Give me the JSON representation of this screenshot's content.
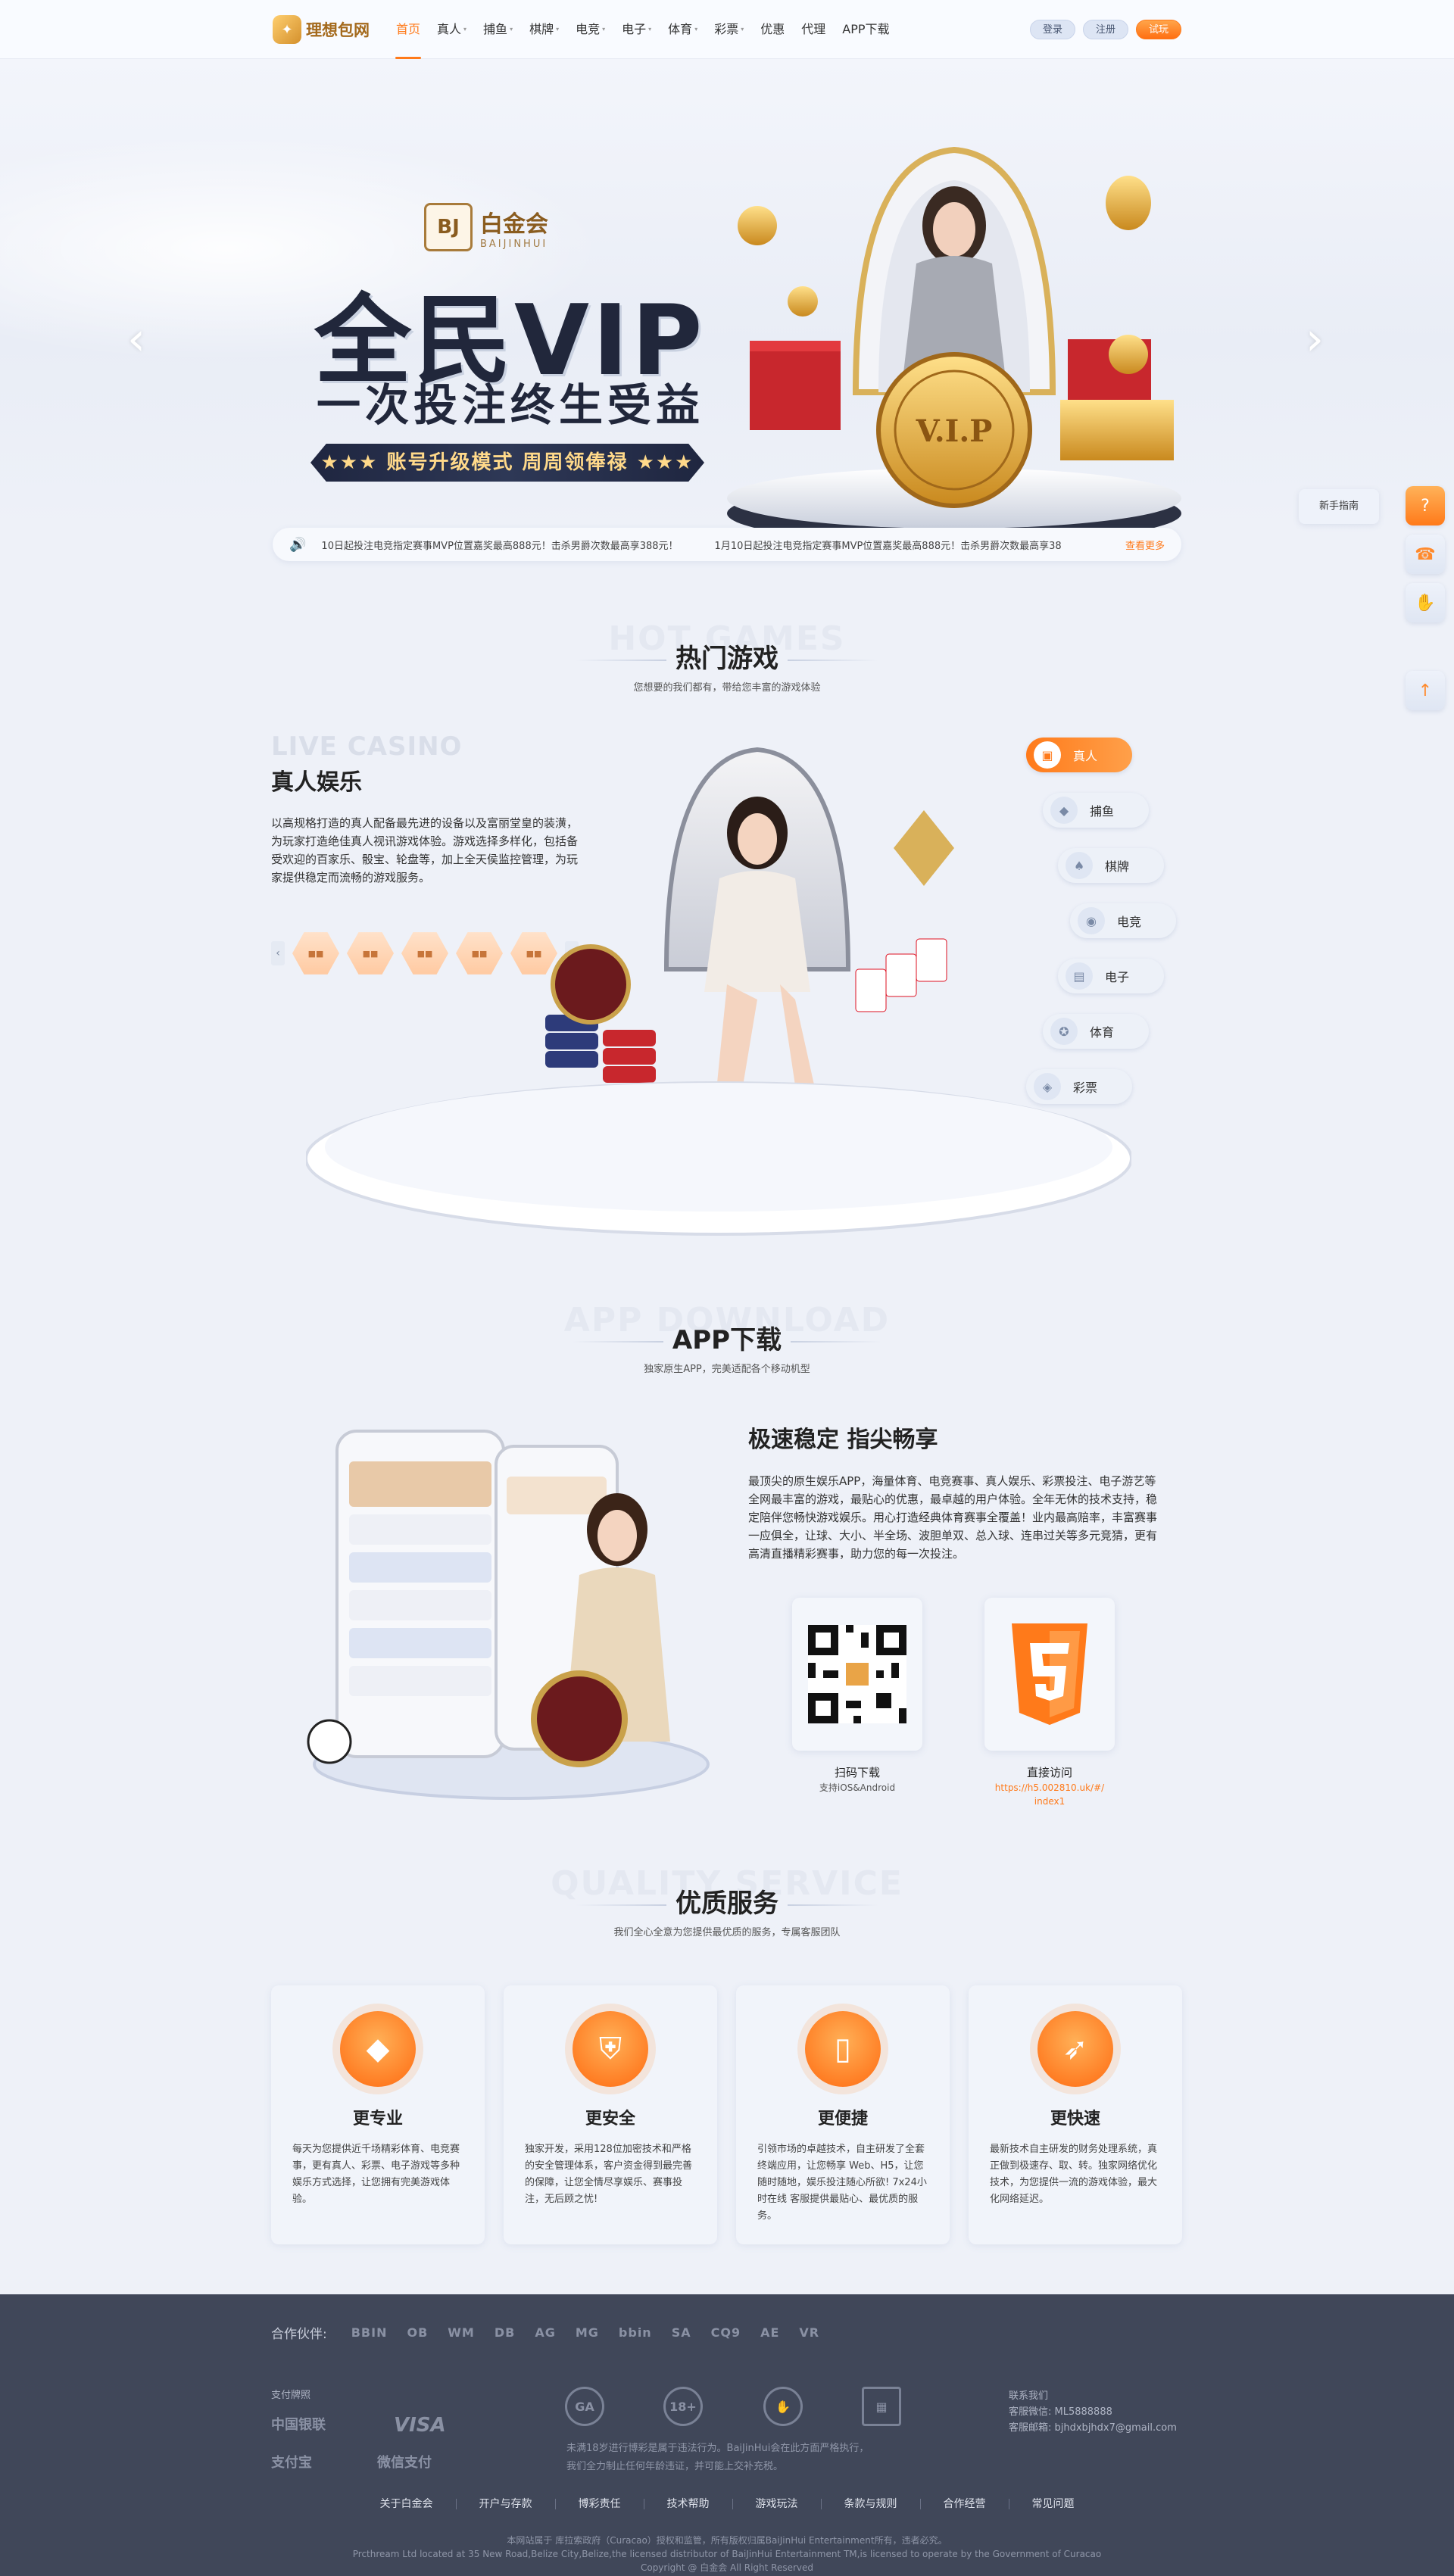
{
  "header": {
    "logo_text": "理想包网",
    "nav": [
      {
        "label": "首页",
        "active": true,
        "caret": false
      },
      {
        "label": "真人",
        "active": false,
        "caret": true
      },
      {
        "label": "捕鱼",
        "active": false,
        "caret": true
      },
      {
        "label": "棋牌",
        "active": false,
        "caret": true
      },
      {
        "label": "电竞",
        "active": false,
        "caret": true
      },
      {
        "label": "电子",
        "active": false,
        "caret": true
      },
      {
        "label": "体育",
        "active": false,
        "caret": true
      },
      {
        "label": "彩票",
        "active": false,
        "caret": true
      },
      {
        "label": "优惠",
        "active": false,
        "caret": false
      },
      {
        "label": "代理",
        "active": false,
        "caret": false
      },
      {
        "label": "APP下载",
        "active": false,
        "caret": false
      }
    ],
    "login": "登录",
    "register": "注册",
    "trial": "试玩"
  },
  "banner": {
    "brand_mark": "BJ",
    "brand_name": "白金会",
    "brand_sub": "BAIJINHUI",
    "title": "全民VIP",
    "subtitle": "一次投注终生受益",
    "ribbon": "★★★ 账号升级模式 周周领俸禄 ★★★",
    "slides": 4,
    "active_slide": 2
  },
  "notice": {
    "messages": [
      "10日起投注电竞指定赛事MVP位置嘉奖最高888元！击杀男爵次数最高享388元！",
      "1月10日起投注电竞指定赛事MVP位置嘉奖最高888元！击杀男爵次数最高享38"
    ],
    "more": "查看更多"
  },
  "side": {
    "guide": "新手指南"
  },
  "hot": {
    "ghost": "HOT GAMES",
    "title": "热门游戏",
    "desc": "您想要的我们都有，带给您丰富的游戏体验",
    "live_ghost": "LIVE CASINO",
    "live_title": "真人娱乐",
    "live_desc": "以高规格打造的真人配备最先进的设备以及富丽堂皇的装潢，为玩家打造绝佳真人视讯游戏体验。游戏选择多样化，包括备受欢迎的百家乐、骰宝、轮盘等，加上全天侯监控管理，为玩家提供稳定而流畅的游戏服务。",
    "thumbs": [
      "■■",
      "■■",
      "■■",
      "■■",
      "■■"
    ],
    "tabs": [
      {
        "label": "真人",
        "icon": "▣",
        "active": true
      },
      {
        "label": "捕鱼",
        "icon": "◆",
        "active": false
      },
      {
        "label": "棋牌",
        "icon": "♠",
        "active": false
      },
      {
        "label": "电竞",
        "icon": "◉",
        "active": false
      },
      {
        "label": "电子",
        "icon": "▤",
        "active": false
      },
      {
        "label": "体育",
        "icon": "✪",
        "active": false
      },
      {
        "label": "彩票",
        "icon": "◈",
        "active": false
      }
    ]
  },
  "app": {
    "ghost": "APP DOWNLOAD",
    "title": "APP下载",
    "desc": "独家原生APP，完美适配各个移动机型",
    "heading": "极速稳定 指尖畅享",
    "body": "最顶尖的原生娱乐APP，海量体育、电竞赛事、真人娱乐、彩票投注、电子游艺等全网最丰富的游戏，最贴心的优惠，最卓越的用户体验。全年无休的技术支持，稳定陪伴您畅快游戏娱乐。用心打造经典体育赛事全覆盖！业内最高赔率，丰富赛事一应俱全，让球、大小、半全场、波胆单双、总入球、连串过关等多元竞猜，更有高清直播精彩赛事，助力您的每一次投注。",
    "scan_label": "扫码下载",
    "scan_sub": "支持iOS&Android",
    "direct_label": "直接访问",
    "direct_url": "https://h5.002810.uk/#/index1",
    "direct_url_lines": [
      "https://h5.002810.uk/#/",
      "index1"
    ]
  },
  "service": {
    "ghost": "QUALITY SERVICE",
    "title": "优质服务",
    "desc": "我们全心全意为您提供最优质的服务，专属客服团队",
    "cards": [
      {
        "name": "更专业",
        "text": "每天为您提供近千场精彩体育、电竞赛事，更有真人、彩票、电子游戏等多种娱乐方式选择，让您拥有完美游戏体验。",
        "icon": "diamond-icon"
      },
      {
        "name": "更安全",
        "text": "独家开发，采用128位加密技术和严格的安全管理体系，客户资金得到最完善的保障，让您全情尽享娱乐、赛事投注，无后顾之忧!",
        "icon": "shield-icon"
      },
      {
        "name": "更便捷",
        "text": "引领市场的卓越技术，自主研发了全套终端应用，让您畅享 Web、H5，让您随时随地，娱乐投注随心所欲! 7x24小时在线 客服提供最贴心、最优质的服务。",
        "icon": "phone-icon"
      },
      {
        "name": "更快速",
        "text": "最新技术自主研发的财务处理系统，真正做到极速存、取、转。独家网络优化技术，为您提供一流的游戏体验，最大化网络延迟。",
        "icon": "rocket-icon"
      }
    ]
  },
  "footer": {
    "partners_label": "合作伙伴:",
    "partners": [
      "BBIN",
      "OB",
      "WM",
      "DB",
      "AG",
      "MG",
      "bbin",
      "SA",
      "CQ9",
      "AE",
      "VR"
    ],
    "pay_label": "支付牌照",
    "pays": [
      "中国银联",
      "VISA",
      "支付宝",
      "微信支付"
    ],
    "license_badges": [
      "GA",
      "18+",
      "✋",
      "▦"
    ],
    "license_text": [
      "未满18岁进行博彩是属于违法行为。BaiJinHui会在此方面严格执行，",
      "我们全力制止任何年龄违证，并可能上交补充税。"
    ],
    "contact_title": "联系我们",
    "contact_wechat": "客服微信:  ML5888888",
    "contact_email": "客服邮箱:  bjhdxbjhdx7@gmail.com",
    "links": [
      "关于白金会",
      "开户与存款",
      "博彩责任",
      "技术帮助",
      "游戏玩法",
      "条款与规则",
      "合作经营",
      "常见问题"
    ],
    "copyright": [
      "本网站属于 库拉索政府（Curacao）授权和监管，所有版权归属BaiJinHui Entertainment所有，违者必究。",
      "Prcthream Ltd located at 35 New Road,Belize City,Belize,the licensed distributor of BaiJinHui Entertainment TM,is licensed to operate by the Government of Curacao",
      "Copyright @ 白金会 All Right Reserved"
    ]
  }
}
